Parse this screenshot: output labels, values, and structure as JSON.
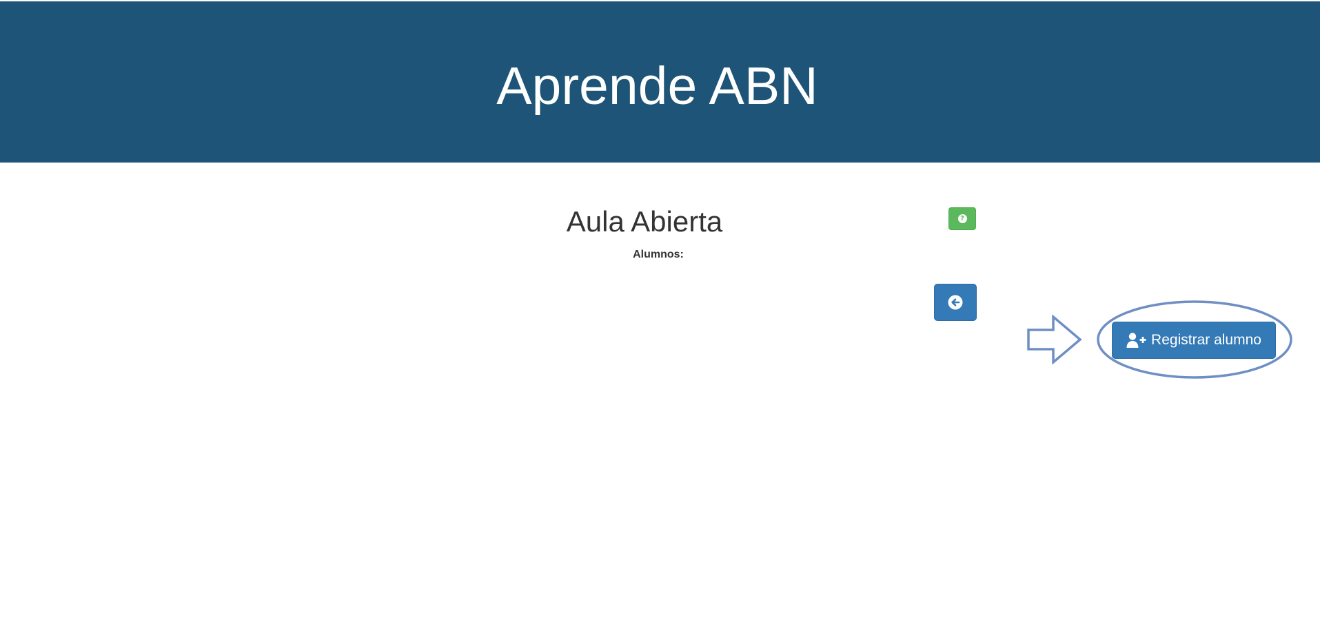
{
  "header": {
    "title": "Aprende ABN",
    "background_color": "#1d5477"
  },
  "main": {
    "classroom_title": "Aula Abierta",
    "students_label": "Alumnos:"
  },
  "actions": {
    "help_icon": "question-circle-icon",
    "help_glyph": "?",
    "help_color": "#5cb85c",
    "back_icon": "arrow-circle-left-icon",
    "register_icon": "user-plus-icon",
    "register_label": "Registrar alumno",
    "primary_color": "#337ab7"
  },
  "annotation": {
    "highlight_color": "#6e8fc4",
    "arrow_icon": "right-arrow-outline"
  }
}
